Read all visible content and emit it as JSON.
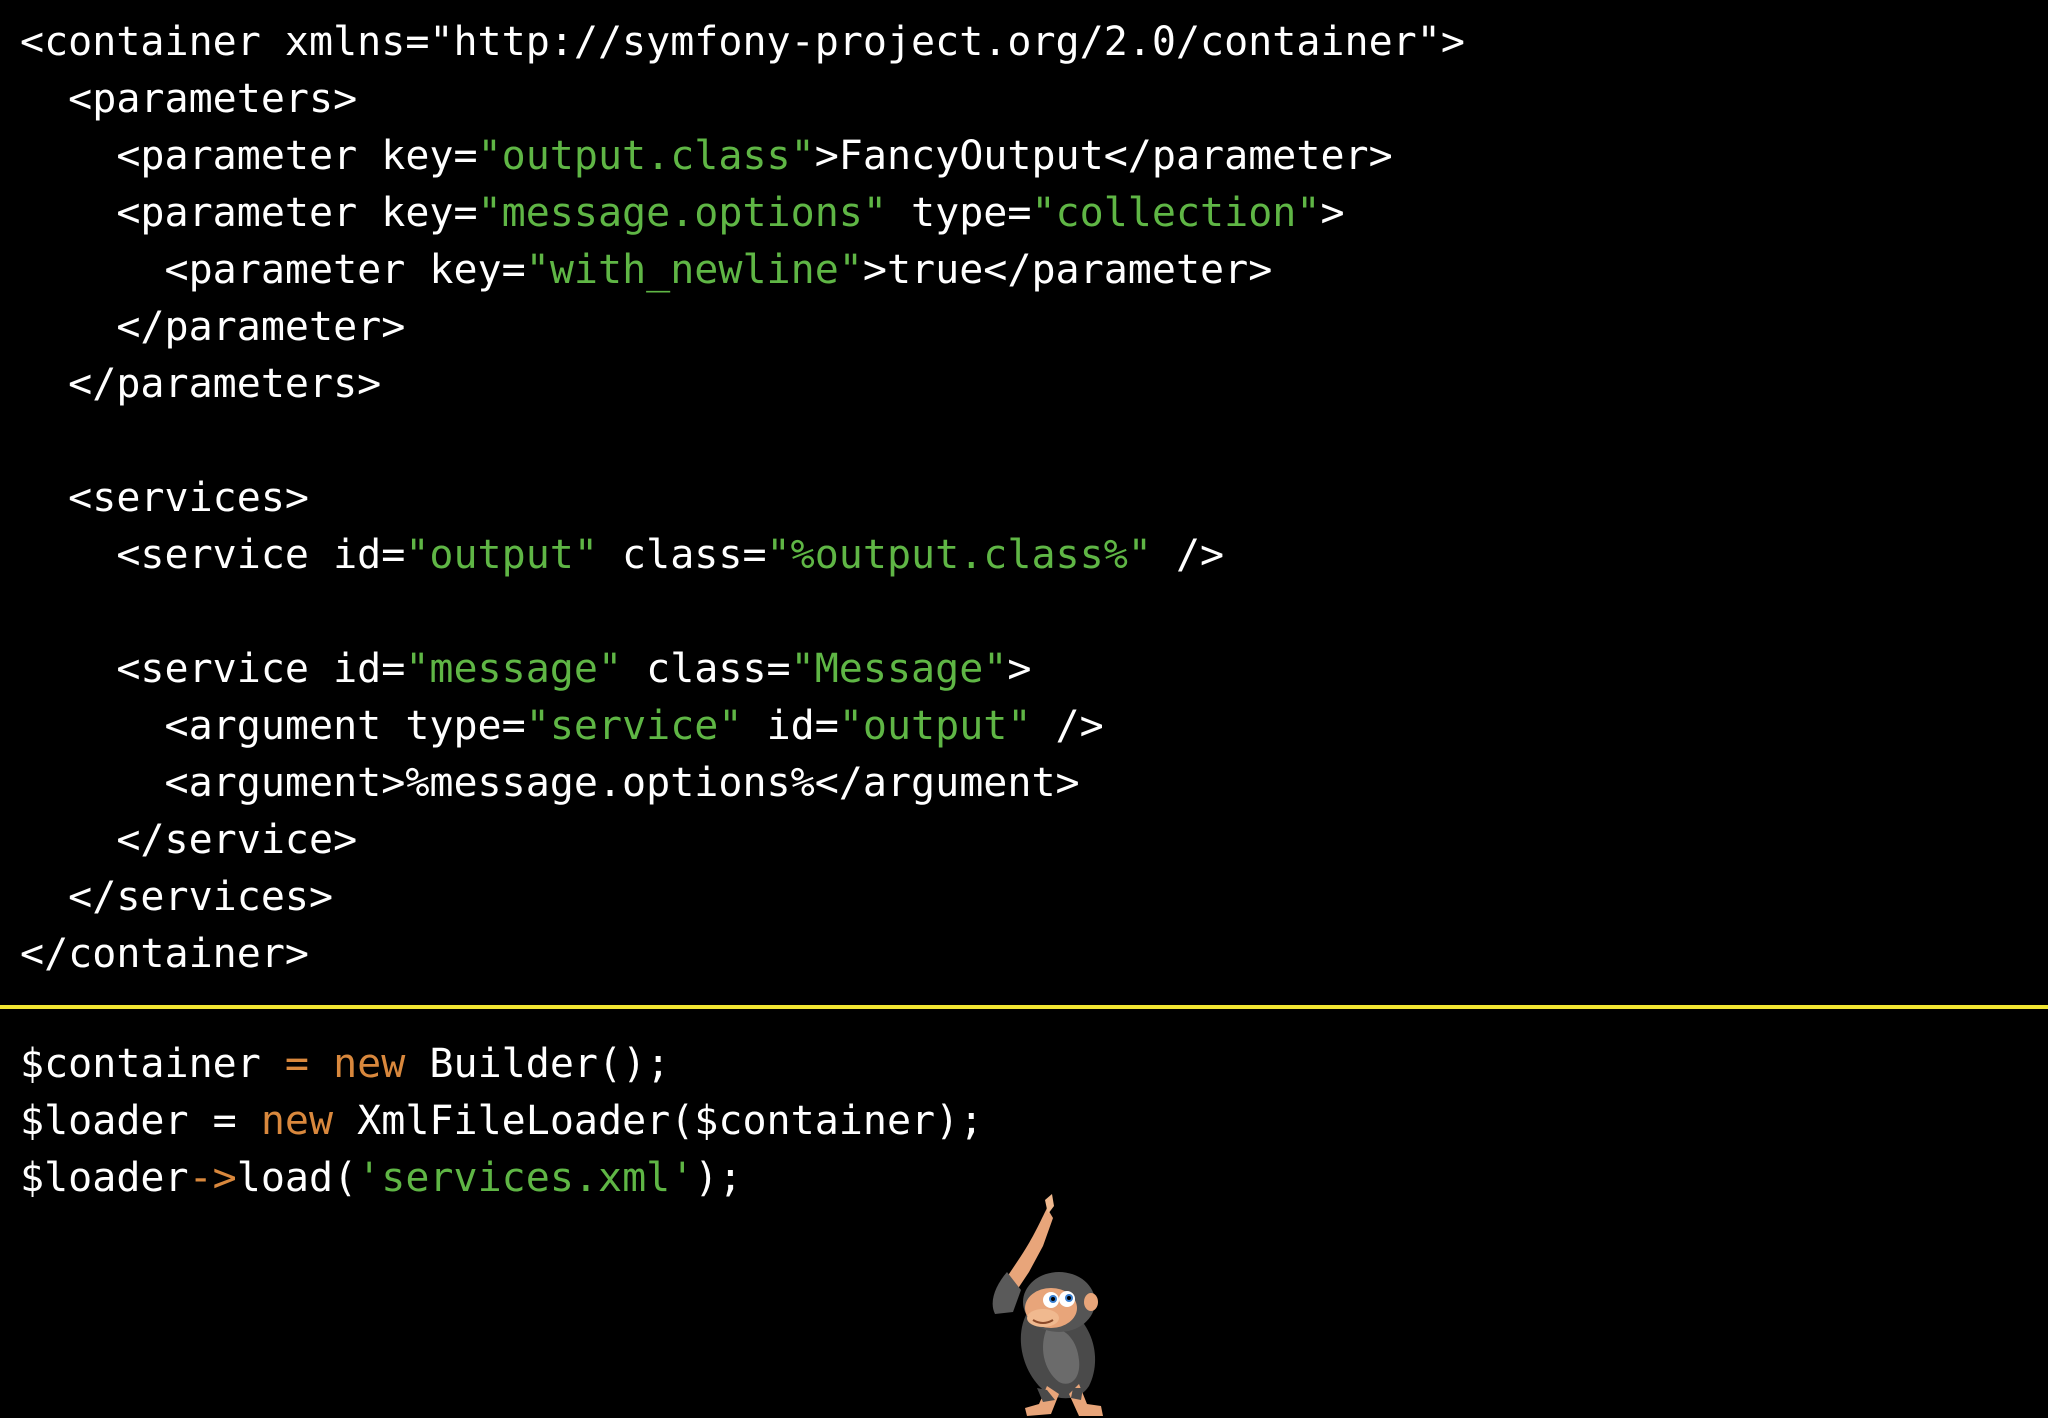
{
  "colors": {
    "background": "#000000",
    "text": "#ffffff",
    "string": "#5fb645",
    "keyword": "#d9883d",
    "separator": "#f2e632"
  },
  "xml_code": [
    [
      {
        "t": "<container xmlns=\"http://symfony-project.org/2.0/container\">",
        "k": "plain"
      }
    ],
    [
      {
        "t": "  <parameters>",
        "k": "plain"
      }
    ],
    [
      {
        "t": "    <parameter key=",
        "k": "plain"
      },
      {
        "t": "\"output.class\"",
        "k": "str"
      },
      {
        "t": ">FancyOutput</parameter>",
        "k": "plain"
      }
    ],
    [
      {
        "t": "    <parameter key=",
        "k": "plain"
      },
      {
        "t": "\"message.options\"",
        "k": "str"
      },
      {
        "t": " type=",
        "k": "plain"
      },
      {
        "t": "\"collection\"",
        "k": "str"
      },
      {
        "t": ">",
        "k": "plain"
      }
    ],
    [
      {
        "t": "      <parameter key=",
        "k": "plain"
      },
      {
        "t": "\"with_newline\"",
        "k": "str"
      },
      {
        "t": ">true</parameter>",
        "k": "plain"
      }
    ],
    [
      {
        "t": "    </parameter>",
        "k": "plain"
      }
    ],
    [
      {
        "t": "  </parameters>",
        "k": "plain"
      }
    ],
    [
      {
        "t": "",
        "k": "plain"
      }
    ],
    [
      {
        "t": "  <services>",
        "k": "plain"
      }
    ],
    [
      {
        "t": "    <service id=",
        "k": "plain"
      },
      {
        "t": "\"output\"",
        "k": "str"
      },
      {
        "t": " class=",
        "k": "plain"
      },
      {
        "t": "\"%output.class%\"",
        "k": "str"
      },
      {
        "t": " />",
        "k": "plain"
      }
    ],
    [
      {
        "t": "",
        "k": "plain"
      }
    ],
    [
      {
        "t": "    <service id=",
        "k": "plain"
      },
      {
        "t": "\"message\"",
        "k": "str"
      },
      {
        "t": " class=",
        "k": "plain"
      },
      {
        "t": "\"Message\"",
        "k": "str"
      },
      {
        "t": ">",
        "k": "plain"
      }
    ],
    [
      {
        "t": "      <argument type=",
        "k": "plain"
      },
      {
        "t": "\"service\"",
        "k": "str"
      },
      {
        "t": " id=",
        "k": "plain"
      },
      {
        "t": "\"output\"",
        "k": "str"
      },
      {
        "t": " />",
        "k": "plain"
      }
    ],
    [
      {
        "t": "      <argument>%message.options%</argument>",
        "k": "plain"
      }
    ],
    [
      {
        "t": "    </service>",
        "k": "plain"
      }
    ],
    [
      {
        "t": "  </services>",
        "k": "plain"
      }
    ],
    [
      {
        "t": "</container>",
        "k": "plain"
      }
    ]
  ],
  "php_code": [
    [
      {
        "t": "$container ",
        "k": "plain"
      },
      {
        "t": "=",
        "k": "op"
      },
      {
        "t": " ",
        "k": "plain"
      },
      {
        "t": "new",
        "k": "kw"
      },
      {
        "t": " Builder();",
        "k": "plain"
      }
    ],
    [
      {
        "t": "$loader = ",
        "k": "plain"
      },
      {
        "t": "new",
        "k": "kw"
      },
      {
        "t": " XmlFileLoader($container);",
        "k": "plain"
      }
    ],
    [
      {
        "t": "$loader",
        "k": "plain"
      },
      {
        "t": "->",
        "k": "op"
      },
      {
        "t": "load(",
        "k": "plain"
      },
      {
        "t": "'services.xml'",
        "k": "str"
      },
      {
        "t": ");",
        "k": "plain"
      }
    ]
  ],
  "mascot": {
    "icon": "monkey-mascot-icon"
  }
}
